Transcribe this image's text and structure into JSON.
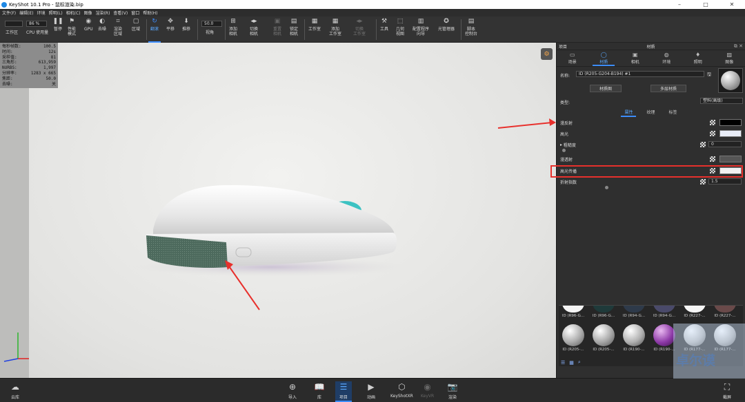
{
  "window": {
    "title": "KeyShot 10.1 Pro - 鼠标渲染.bip",
    "minimize": "–",
    "maximize": "□",
    "close": "✕"
  },
  "menu": [
    "文件(F)",
    "编辑(E)",
    "环境",
    "照明(L)",
    "相机(C)",
    "图像",
    "渲染(R)",
    "查看(V)",
    "窗口",
    "帮助(H)"
  ],
  "toolbar": {
    "workarea_label": "工作区",
    "cpu_percent": "86 %",
    "cpu_label": "CPU 使用量",
    "pause_label": "暂停",
    "perf_label": "性能\n模式",
    "gpu_label": "GPU",
    "denoise_label": "去噪",
    "region_label": "渲染\n区域",
    "region2_label": "区域",
    "tumble_label": "翻滚",
    "pan_label": "平移",
    "dolly_label": "推移",
    "fov_value": "50.0",
    "fov_label": "视角",
    "add_camera_label": "添加\n相机",
    "switch_camera_label": "切换\n相机",
    "reset_camera_label": "重置\n相机",
    "lock_camera_label": "锁定\n相机",
    "studio_label": "工作室",
    "add_studio_label": "添加\n工作室",
    "switch_studio_label": "切换\n工作室",
    "tools_label": "工具",
    "geometry_view_label": "几何\n视图",
    "config_wizard_label": "配置程序\n向导",
    "light_manager_label": "光管理器",
    "script_console_label": "脚本\n控制台"
  },
  "stats": [
    {
      "k": "每秒帧数:",
      "v": "100.5"
    },
    {
      "k": "时间:",
      "v": "12s"
    },
    {
      "k": "采样值:",
      "v": "81"
    },
    {
      "k": "三角形:",
      "v": "613,959"
    },
    {
      "k": "NURBS:",
      "v": "1,997"
    },
    {
      "k": "分辨率:",
      "v": "1283 x 665"
    },
    {
      "k": "焦距:",
      "v": "50.0"
    },
    {
      "k": "去噪:",
      "v": "关"
    }
  ],
  "panel": {
    "left_title": "项目",
    "title": "材质",
    "tabs": [
      "场景",
      "材质",
      "相机",
      "环境",
      "照明",
      "图像"
    ],
    "name_label": "名称:",
    "name_value": "ID (R205-G204-B194) #1",
    "material_graph_btn": "材质图",
    "multi_material_btn": "多层材质",
    "type_label": "类型:",
    "type_value": "塑料(高级)",
    "subtabs": [
      "属性",
      "纹理",
      "标签"
    ],
    "props": {
      "diffuse": "漫反射",
      "specular": "高光",
      "roughness": "粗糙度",
      "roughness_value": "0",
      "diffuse_transmission": "漫透射",
      "specular_transmission": "高光传播",
      "refractive_index": "折射指数",
      "refractive_index_value": "1.5"
    },
    "colors": {
      "diffuse": "#000000",
      "specular": "#e9edf7",
      "diffuse_transmission": "#555555",
      "specular_transmission": "#f2f2f2"
    }
  },
  "library": {
    "top_labels": [
      "ID (R96-G...",
      "ID (R96-G...",
      "ID (R94-G...",
      "ID (R94-G...",
      "ID (R227-...",
      "ID (R227-..."
    ],
    "bottom_labels": [
      "ID (R205-...",
      "ID (R205-...",
      "ID (R190-...",
      "ID (R190-...",
      "ID (R177-...",
      "ID (R177-..."
    ]
  },
  "bottom": {
    "cloud": "云库",
    "import": "导入",
    "library": "库",
    "project": "项目",
    "animation": "动画",
    "keyshotxr": "KeyShotXR",
    "keyvr": "KeyVR",
    "render": "渲染",
    "expert": "截屏"
  },
  "watermark": "卓尔谟"
}
